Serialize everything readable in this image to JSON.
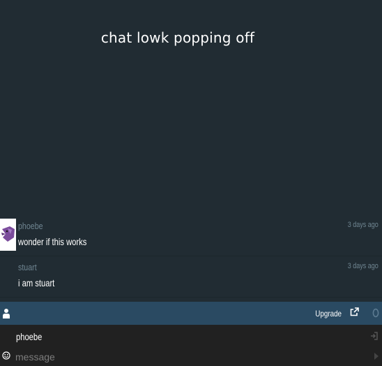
{
  "page": {
    "title": "chat lowk popping off"
  },
  "messages": [
    {
      "author": "phoebe",
      "time": "3 days ago",
      "text": "wonder if this works",
      "avatar": "purple-bird-avatar"
    },
    {
      "author": "stuart",
      "time": "3 days ago",
      "text": "i am stuart",
      "avatar": ""
    }
  ],
  "toolbar": {
    "upgrade_label": "Upgrade",
    "icons": [
      "user-icon",
      "external-link-icon",
      "online-count-icon"
    ]
  },
  "composer": {
    "username": "phoebe",
    "placeholder": "message",
    "icons": [
      "emoji-icon",
      "login-icon",
      "send-icon"
    ]
  },
  "colors": {
    "background": "#212c33",
    "toolbar": "#2a4a62",
    "composer": "#212121",
    "muted_text": "#6f8591",
    "avatar_bird": "#7b4c9c"
  }
}
